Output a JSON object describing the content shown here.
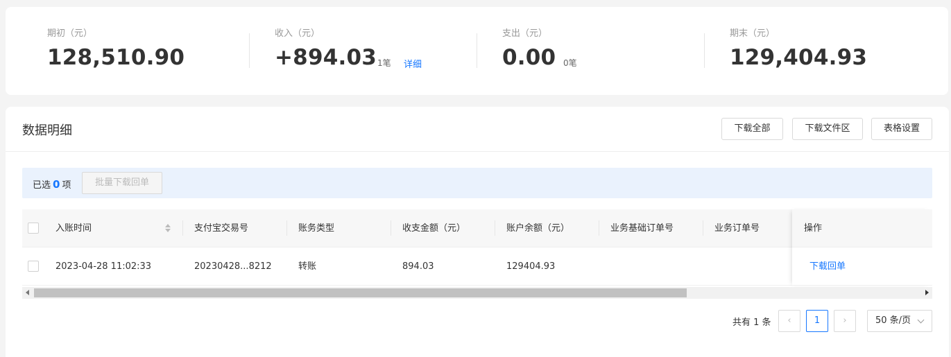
{
  "summary": {
    "opening": {
      "label": "期初（元）",
      "value": "128,510.90"
    },
    "income": {
      "label": "收入（元）",
      "value": "+894.03",
      "count": "1笔",
      "link": "详细"
    },
    "expense": {
      "label": "支出（元）",
      "value": "0.00",
      "count": "0笔"
    },
    "closing": {
      "label": "期末（元）",
      "value": "129,404.93"
    }
  },
  "detail": {
    "title": "数据明细",
    "buttons": {
      "download_all": "下载全部",
      "download_area": "下载文件区",
      "table_settings": "表格设置"
    },
    "selection": {
      "prefix": "已选",
      "count": "0",
      "suffix": "项",
      "batch_button": "批量下载回单"
    },
    "table": {
      "columns": [
        "入账时间",
        "支付宝交易号",
        "账务类型",
        "收支金额（元）",
        "账户余额（元）",
        "业务基础订单号",
        "业务订单号",
        "操作"
      ],
      "rows": [
        {
          "time": "2023-04-28 11:02:33",
          "trade_no": "20230428...8212",
          "type": "转账",
          "amount": "894.03",
          "balance": "129404.93",
          "base_order": "",
          "order": "",
          "action": "下载回单"
        }
      ]
    },
    "pagination": {
      "total": "共有 1 条",
      "current_page": "1",
      "page_size": "50 条/页",
      "prev_icon": "‹",
      "next_icon": "›"
    }
  },
  "colors": {
    "accent": "#1677ff",
    "selection_bg": "#eaf2fd",
    "page_bg": "#f4f4f4"
  }
}
